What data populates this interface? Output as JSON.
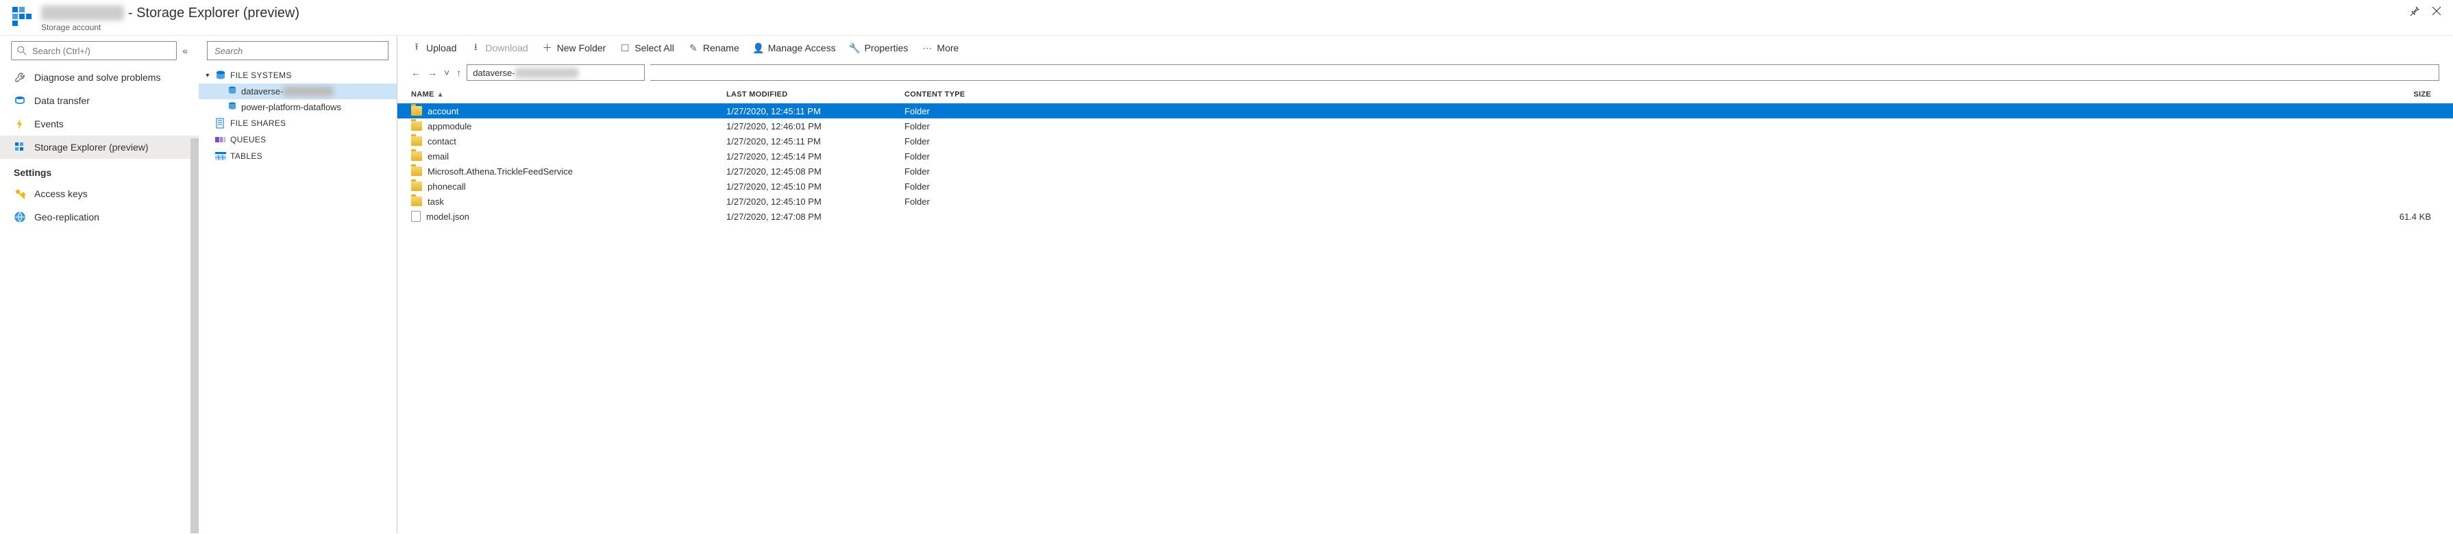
{
  "header": {
    "title_prefix": "████████",
    "title_suffix": " - Storage Explorer (preview)",
    "subtitle": "Storage account"
  },
  "leftnav": {
    "search_placeholder": "Search (Ctrl+/)",
    "items": [
      {
        "id": "diagnose",
        "label": "Diagnose and solve problems"
      },
      {
        "id": "transfer",
        "label": "Data transfer"
      },
      {
        "id": "events",
        "label": "Events"
      },
      {
        "id": "explorer",
        "label": "Storage Explorer (preview)",
        "active": true
      }
    ],
    "settings_header": "Settings",
    "settings_items": [
      {
        "id": "keys",
        "label": "Access keys"
      },
      {
        "id": "geo",
        "label": "Geo-replication"
      }
    ]
  },
  "tree": {
    "search_placeholder": "Search",
    "groups": [
      {
        "id": "fs",
        "label": "FILE SYSTEMS",
        "expanded": true,
        "children": [
          {
            "id": "dv",
            "label": "dataverse-",
            "redacted": "████████",
            "selected": true
          },
          {
            "id": "ppd",
            "label": "power-platform-dataflows"
          }
        ]
      },
      {
        "id": "shares",
        "label": "FILE SHARES"
      },
      {
        "id": "queues",
        "label": "QUEUES"
      },
      {
        "id": "tables",
        "label": "TABLES"
      }
    ]
  },
  "toolbar": {
    "upload": "Upload",
    "download": "Download",
    "newfolder": "New Folder",
    "selectall": "Select All",
    "rename": "Rename",
    "manage": "Manage Access",
    "properties": "Properties",
    "more": "More"
  },
  "breadcrumb": {
    "path_prefix": "dataverse-",
    "path_redacted": "██████████"
  },
  "table": {
    "headers": {
      "name": "NAME",
      "modified": "LAST MODIFIED",
      "type": "CONTENT TYPE",
      "size": "SIZE"
    },
    "rows": [
      {
        "name": "account",
        "modified": "1/27/2020, 12:45:11 PM",
        "type": "Folder",
        "size": "",
        "kind": "folder",
        "selected": true
      },
      {
        "name": "appmodule",
        "modified": "1/27/2020, 12:46:01 PM",
        "type": "Folder",
        "size": "",
        "kind": "folder"
      },
      {
        "name": "contact",
        "modified": "1/27/2020, 12:45:11 PM",
        "type": "Folder",
        "size": "",
        "kind": "folder"
      },
      {
        "name": "email",
        "modified": "1/27/2020, 12:45:14 PM",
        "type": "Folder",
        "size": "",
        "kind": "folder"
      },
      {
        "name": "Microsoft.Athena.TrickleFeedService",
        "modified": "1/27/2020, 12:45:08 PM",
        "type": "Folder",
        "size": "",
        "kind": "folder"
      },
      {
        "name": "phonecall",
        "modified": "1/27/2020, 12:45:10 PM",
        "type": "Folder",
        "size": "",
        "kind": "folder"
      },
      {
        "name": "task",
        "modified": "1/27/2020, 12:45:10 PM",
        "type": "Folder",
        "size": "",
        "kind": "folder"
      },
      {
        "name": "model.json",
        "modified": "1/27/2020, 12:47:08 PM",
        "type": "",
        "size": "61.4 KB",
        "kind": "file"
      }
    ]
  }
}
